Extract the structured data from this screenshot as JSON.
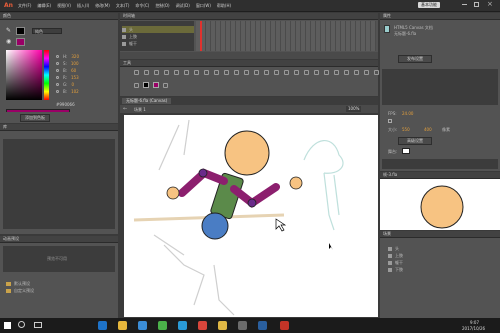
{
  "app": {
    "logo": "An",
    "menu": [
      "文件(F)",
      "编辑(E)",
      "视图(V)",
      "插入(I)",
      "修改(M)",
      "文本(T)",
      "命令(C)",
      "控制(O)",
      "调试(D)",
      "窗口(W)",
      "帮助(H)"
    ],
    "workspace_badge": "基本功能"
  },
  "color_panel": {
    "tab": "颜色",
    "mode": "纯色",
    "hex_value": "#990066",
    "add_swatch_button": "添加到色板",
    "labels": [
      "H:",
      "S:",
      "B:",
      "R:",
      "G:",
      "B:"
    ],
    "values": [
      "320",
      "100",
      "60",
      "153",
      "0",
      "102"
    ],
    "fill_color": "#990066"
  },
  "library_panel": {
    "tab": "库"
  },
  "motion_panel": {
    "tab": "动画预设",
    "empty_text": "预览不可用",
    "folders": [
      "默认预设",
      "自定义预设"
    ]
  },
  "timeline": {
    "tab": "时间轴",
    "layers": [
      "头",
      "上肢",
      "躯干"
    ]
  },
  "tools": {
    "tab": "工具"
  },
  "stage": {
    "tab": "无标题-6.fla (Canvas)",
    "scene": "场景 1",
    "zoom": "100%"
  },
  "properties": {
    "tab": "属性",
    "doc_type": "HTML5 Canvas 文档",
    "doc_name": "无标题-6.fla",
    "publish_settings_button": "发布设置",
    "fps_label": "FPS:",
    "fps_value": "24.00",
    "size_label": "大小:",
    "width": "550",
    "height": "400",
    "unit": "像素",
    "stage_label": "舞台:",
    "advanced_button": "高级设置"
  },
  "preview": {
    "tab": "帧-3.fla"
  },
  "scene_panel": {
    "tab": "场景",
    "items": [
      "头",
      "上肢",
      "躯干",
      "下肢"
    ]
  },
  "taskbar": {
    "time": "9:07",
    "date": "2017/10/26"
  }
}
